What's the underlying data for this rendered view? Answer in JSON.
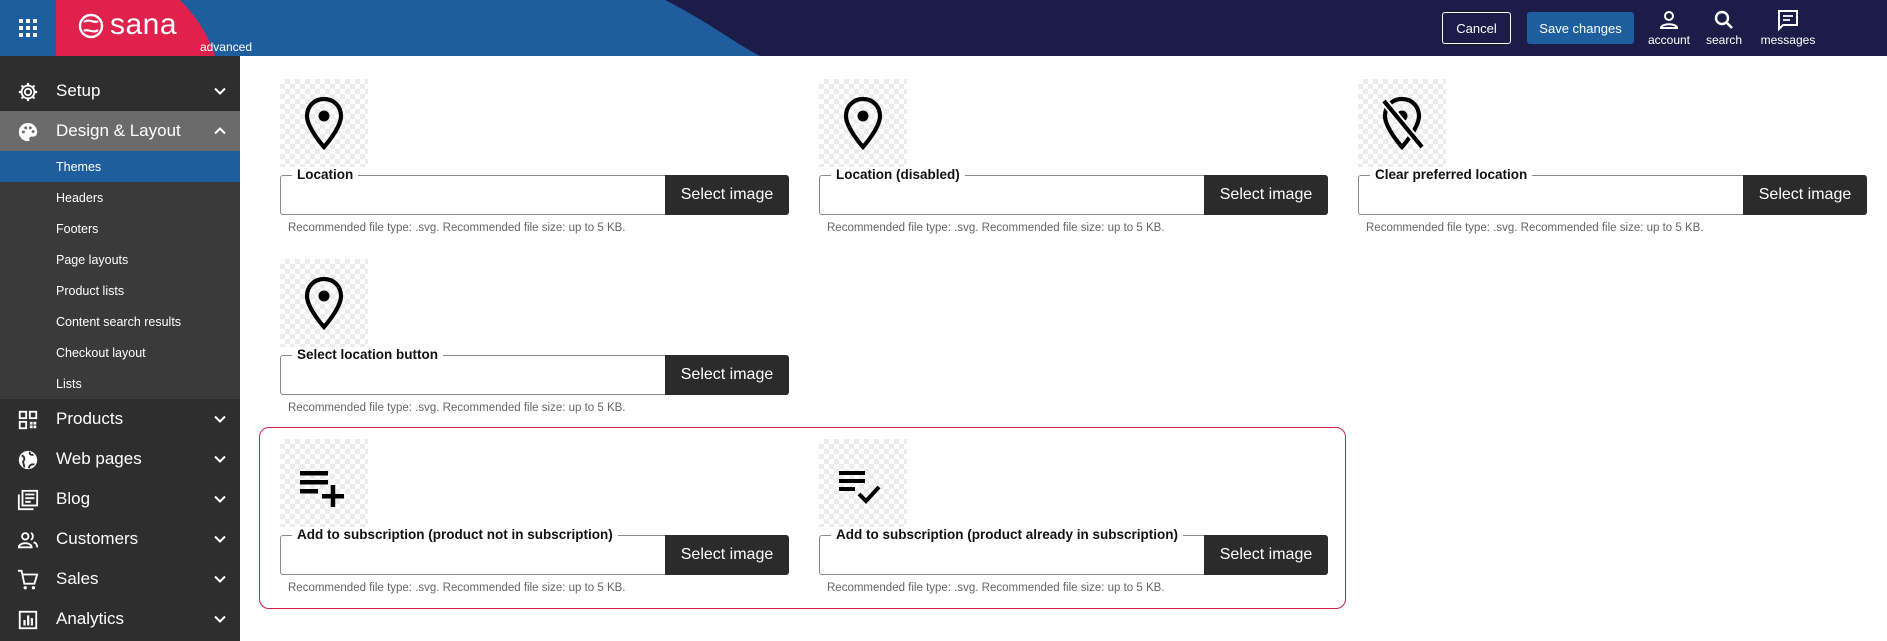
{
  "header": {
    "brand_name": "sana",
    "brand_edition": "advanced",
    "cancel_label": "Cancel",
    "save_label": "Save changes",
    "actions": {
      "account": "account",
      "search": "search",
      "messages": "messages"
    },
    "colors": {
      "bar": "#1b1d48",
      "accent_red": "#e0214b",
      "accent_blue": "#1f5e9e"
    }
  },
  "sidebar": {
    "setup": "Setup",
    "design": "Design & Layout",
    "design_sub": [
      "Themes",
      "Headers",
      "Footers",
      "Page layouts",
      "Product lists",
      "Content search results",
      "Checkout layout",
      "Lists"
    ],
    "products": "Products",
    "web_pages": "Web pages",
    "blog": "Blog",
    "customers": "Customers",
    "sales": "Sales",
    "analytics": "Analytics"
  },
  "fields": [
    {
      "label": "Location",
      "button": "Select image",
      "hint": "Recommended file type: .svg. Recommended file size: up to 5 KB.",
      "icon": "location-pin-icon"
    },
    {
      "label": "Location (disabled)",
      "button": "Select image",
      "hint": "Recommended file type: .svg. Recommended file size: up to 5 KB.",
      "icon": "location-pin-icon"
    },
    {
      "label": "Clear preferred location",
      "button": "Select image",
      "hint": "Recommended file type: .svg. Recommended file size: up to 5 KB.",
      "icon": "location-off-icon"
    },
    {
      "label": "Select location button",
      "button": "Select image",
      "hint": "Recommended file type: .svg. Recommended file size: up to 5 KB.",
      "icon": "location-pin-icon"
    },
    {
      "label": "Add to subscription (product not in subscription)",
      "button": "Select image",
      "hint": "Recommended file type: .svg. Recommended file size: up to 5 KB.",
      "icon": "playlist-add-icon"
    },
    {
      "label": "Add to subscription (product already in subscription)",
      "button": "Select image",
      "hint": "Recommended file type: .svg. Recommended file size: up to 5 KB.",
      "icon": "playlist-check-icon"
    }
  ]
}
